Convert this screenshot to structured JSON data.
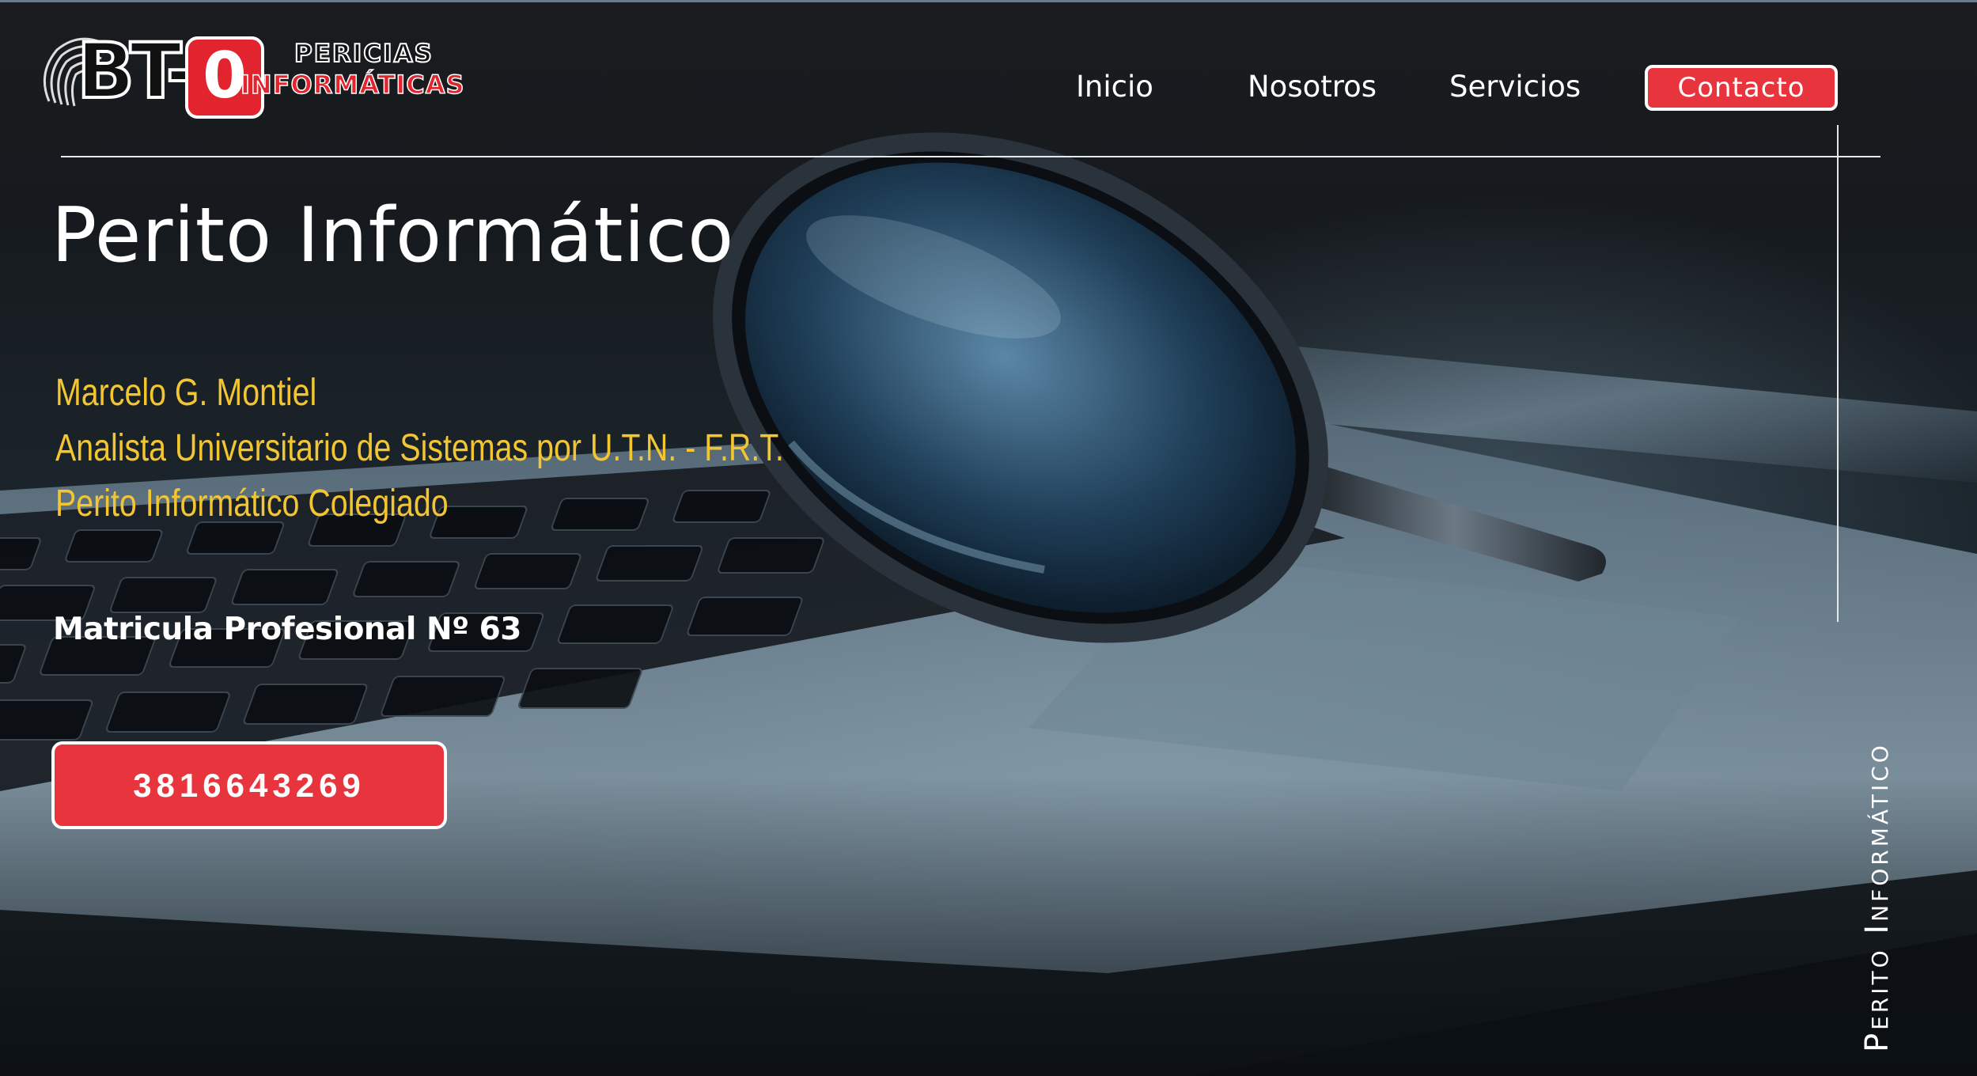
{
  "brand": {
    "logo_main": "BT-",
    "logo_zero": "0",
    "logo_line1": "PERICIAS",
    "logo_line2": "INFORMÁTICAS"
  },
  "nav": {
    "items": [
      {
        "label": "Inicio"
      },
      {
        "label": "Nosotros"
      },
      {
        "label": "Servicios"
      }
    ],
    "contact_label": "Contacto"
  },
  "hero": {
    "title": "Perito Informático",
    "credentials": [
      "Marcelo G. Montiel",
      "Analista Universitario de Sistemas por U.T.N. - F.R.T.",
      "Perito Informático Colegiado"
    ],
    "registration": "Matricula Profesional Nº 63",
    "phone": "3816643269",
    "side_label": "Perito Informático"
  },
  "colors": {
    "accent_red": "#e8343d",
    "credential_yellow": "#f2c531",
    "text_white": "#ffffff"
  },
  "icons": {
    "hero_image": "magnifying-glass-over-laptop",
    "logo_fingerprint": "fingerprint-icon"
  }
}
